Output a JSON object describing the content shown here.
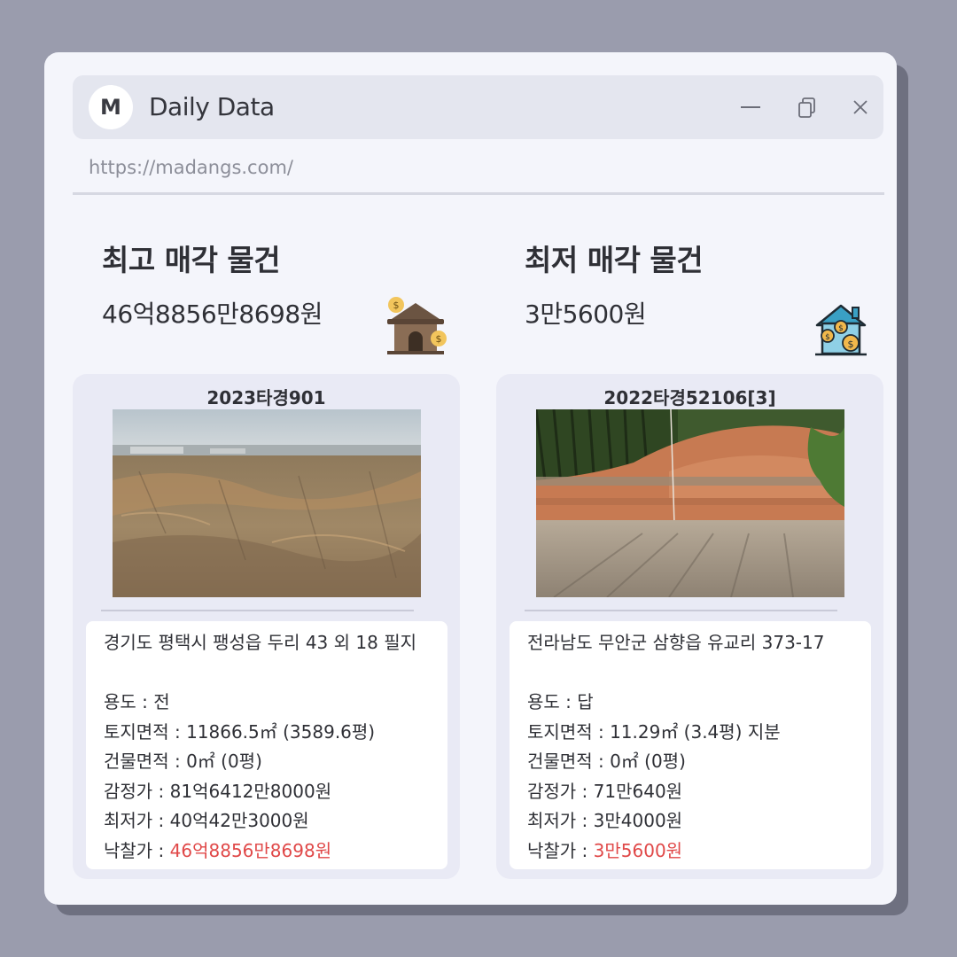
{
  "window": {
    "logo_letter": "M",
    "title": "Daily Data",
    "url": "https://madangs.com/"
  },
  "highest": {
    "heading": "최고 매각 물건",
    "price": "46억8856만8698원",
    "case_no": "2023타경901",
    "address": "경기도 평택시 팽성읍 두리 43 외 18 필지",
    "usage_label": "용도 : ",
    "usage": "전",
    "land_area_label": "토지면적 : ",
    "land_area": "11866.5㎡ (3589.6평)",
    "building_area_label": "건물면적 : ",
    "building_area": "0㎡ (0평)",
    "appraisal_label": "감정가 : ",
    "appraisal": "81억6412만8000원",
    "minimum_label": "최저가 : ",
    "minimum": "40억42만3000원",
    "winning_label": "낙찰가 : ",
    "winning": "46억8856만8698원"
  },
  "lowest": {
    "heading": "최저 매각 물건",
    "price": "3만5600원",
    "case_no": "2022타경52106[3]",
    "address": "전라남도 무안군 삼향읍 유교리 373-17",
    "usage_label": "용도 : ",
    "usage": "답",
    "land_area_label": "토지면적 : ",
    "land_area": "11.29㎡ (3.4평) 지분",
    "building_area_label": "건물면적 : ",
    "building_area": "0㎡ (0평)",
    "appraisal_label": "감정가 : ",
    "appraisal": "71만640원",
    "minimum_label": "최저가 : ",
    "minimum": "3만4000원",
    "winning_label": "낙찰가 : ",
    "winning": "3만5600원"
  },
  "colors": {
    "background": "#9a9cad",
    "window": "#f4f5fb",
    "card": "#e9eaf5",
    "price_highlight": "#e04848"
  },
  "icons": [
    "minimize-icon",
    "restore-icon",
    "close-icon",
    "house-money-icon",
    "house-coins-icon"
  ]
}
